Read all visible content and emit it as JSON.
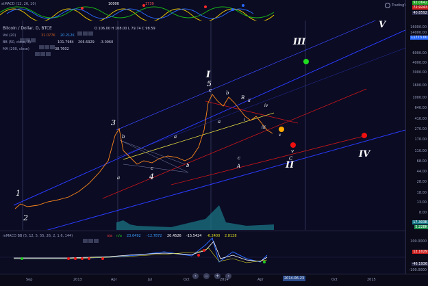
{
  "top": {
    "title": "stMACD (12, 26, 10)",
    "value": "10000",
    "extra": "1739",
    "right_label": "TradingView",
    "tags": [
      "92.0642",
      "72.9243",
      "40.8592"
    ]
  },
  "main": {
    "title": "Bitcoin / Dollar, D, BTCE",
    "ohlc": "O 106.00  H 108.00  L 79.74  C 98.59",
    "vol": "Vol (20)",
    "vol_vals": [
      "31.077K",
      "20.212K"
    ],
    "bb": "BB (50, close, 3)",
    "bb_vals": [
      "101.7984",
      "206.6929",
      "-3.0960"
    ],
    "ma": "MA (200, close)",
    "ma_val": "38.7602",
    "price_ticks": [
      "16000.00",
      "14000.00",
      "11773.00",
      "6000.00",
      "4000.00",
      "3000.00",
      "1600.00",
      "1000.00",
      "640.00",
      "410.00",
      "270.00",
      "170.00",
      "110.00",
      "68.00",
      "44.00",
      "28.00",
      "18.00",
      "13.00",
      "8.00"
    ],
    "price_tag_blue": "11773.00",
    "vol_tags": [
      "17.303K",
      "5.228K"
    ]
  },
  "waves": {
    "w1": "1",
    "w2": "2",
    "w3": "3",
    "w4": "4",
    "w5": "5",
    "wI": "I",
    "wII": "II",
    "wIII": "III",
    "wIV": "IV",
    "wV": "V",
    "a1": "a",
    "b1": "b",
    "c1": "c",
    "a2": "a",
    "b2": "b",
    "a3": "a",
    "b3": "b",
    "c3": "c",
    "A": "A",
    "B": "B",
    "C": "C",
    "i": "i",
    "ii": "ii",
    "iii": "iii",
    "iv": "iv",
    "v": "v",
    "cA": "c",
    "bB": "b",
    "vC": "v"
  },
  "macd": {
    "title": "mMACD BB (5, 12, 5, 55, 26, 2, 1.6, 144)",
    "vals": [
      "n/a",
      "n/a",
      "23.6492",
      "-12.7872",
      "20.4526",
      "-15.5424",
      "-6.2400",
      "2.8128"
    ],
    "ticks": [
      "100.0000",
      "12.1029",
      "-46.1936",
      "-100.0000"
    ]
  },
  "xaxis": {
    "labels": [
      "Sep",
      "2013",
      "Apr",
      "Jul",
      "Oct",
      "2014",
      "Apr",
      "Oct",
      "2015"
    ],
    "selected_date": "2014-06-23"
  },
  "colors": {
    "bg": "#0b0b24",
    "price": "#ff8a1a",
    "bb": "#4a60ff",
    "accent": "#ff2a2a"
  }
}
